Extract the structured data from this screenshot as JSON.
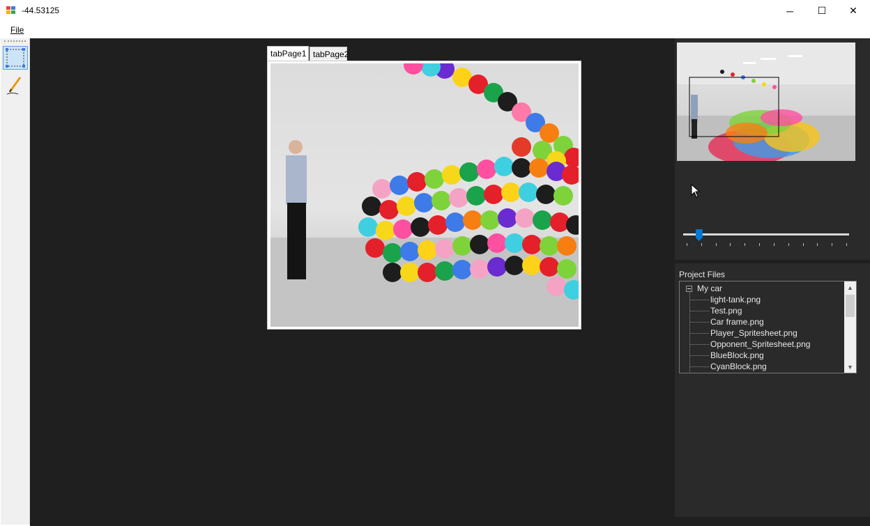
{
  "window": {
    "title": "-44.53125",
    "controls": {
      "minimize": "─",
      "maximize": "☐",
      "close": "✕"
    }
  },
  "menu": {
    "items": [
      {
        "label": "File"
      }
    ]
  },
  "toolbar": {
    "tools": [
      {
        "name": "select-tool",
        "icon": "selection-rectangle-icon",
        "active": true
      },
      {
        "name": "pencil-tool",
        "icon": "pencil-icon",
        "active": false
      }
    ]
  },
  "tabs": [
    {
      "label": "tabPage1",
      "active": true
    },
    {
      "label": "tabPage2",
      "active": false
    }
  ],
  "zoom": {
    "slider_fraction": 0.1,
    "tick_count": 12
  },
  "project_files": {
    "label": "Project Files",
    "root": "My car",
    "items": [
      "light-tank.png",
      "Test.png",
      "Car frame.png",
      "Player_Spritesheet.png",
      "Opponent_Spritesheet.png",
      "BlueBlock.png",
      "CyanBlock.png"
    ]
  },
  "colors": {
    "accent": "#0078d7",
    "canvas_bg": "#1f1f1f",
    "panel_bg": "#2a2a2a"
  }
}
